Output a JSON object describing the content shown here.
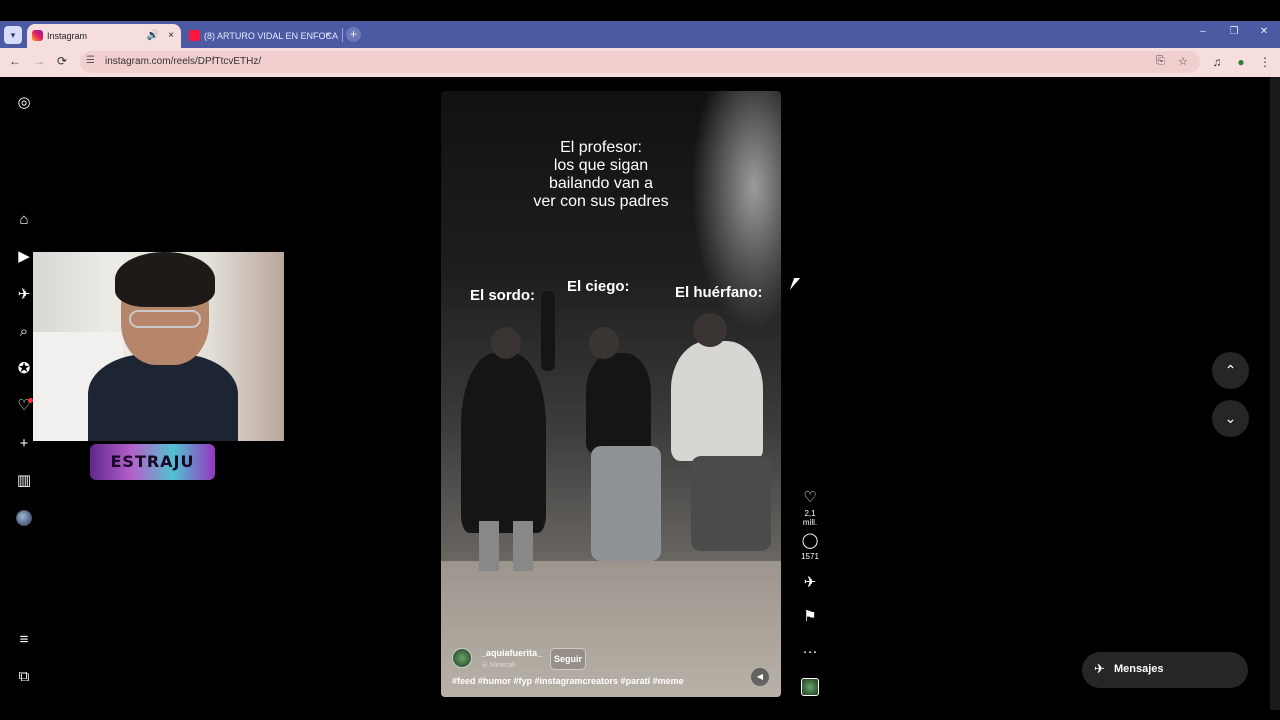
{
  "browser": {
    "tabs": [
      {
        "title": "Instagram"
      },
      {
        "title": "(8) ARTURO VIDAL EN ENFOCA"
      }
    ],
    "url": "instagram.com/reels/DPfTtcvETHz/"
  },
  "icons": {
    "tab_menu": "▾",
    "speaker": "🔊",
    "close": "×",
    "new_tab": "+",
    "minimize": "–",
    "restore": "❐",
    "win_close": "✕",
    "back": "←",
    "forward": "→",
    "reload": "⟳",
    "site_info": "☰",
    "install": "⎘",
    "star": "☆",
    "media": "♫",
    "extension": "●",
    "kebab": "⋮",
    "instagram": "◎",
    "home": "⌂",
    "reels": "▶",
    "send": "✈",
    "search": "⌕",
    "explore": "✪",
    "heart": "♡",
    "create": "+",
    "dashboard": "▥",
    "more": "≡",
    "meta": "⧉",
    "like": "♡",
    "comment": "◯",
    "share": "✈",
    "save": "⚑",
    "dots": "···",
    "mute": "◀",
    "up": "⌃",
    "down": "⌄"
  },
  "webcam": {
    "logo_text": "ESTRAJU"
  },
  "reel": {
    "caption": "El profesor:\nlos que sigan\nbailando van a\nver con sus padres",
    "labels": [
      "El sordo:",
      "El ciego:",
      "El huérfano:"
    ],
    "username": "_aquiafuerita_",
    "location": "Mexicali",
    "follow_label": "Seguir",
    "hashtags": "#feed #humor #fyp #instagramcreators #parati #meme"
  },
  "actions": {
    "likes": "2,1 mill.",
    "comments": "1571"
  },
  "messages": {
    "label": "Mensajes"
  }
}
